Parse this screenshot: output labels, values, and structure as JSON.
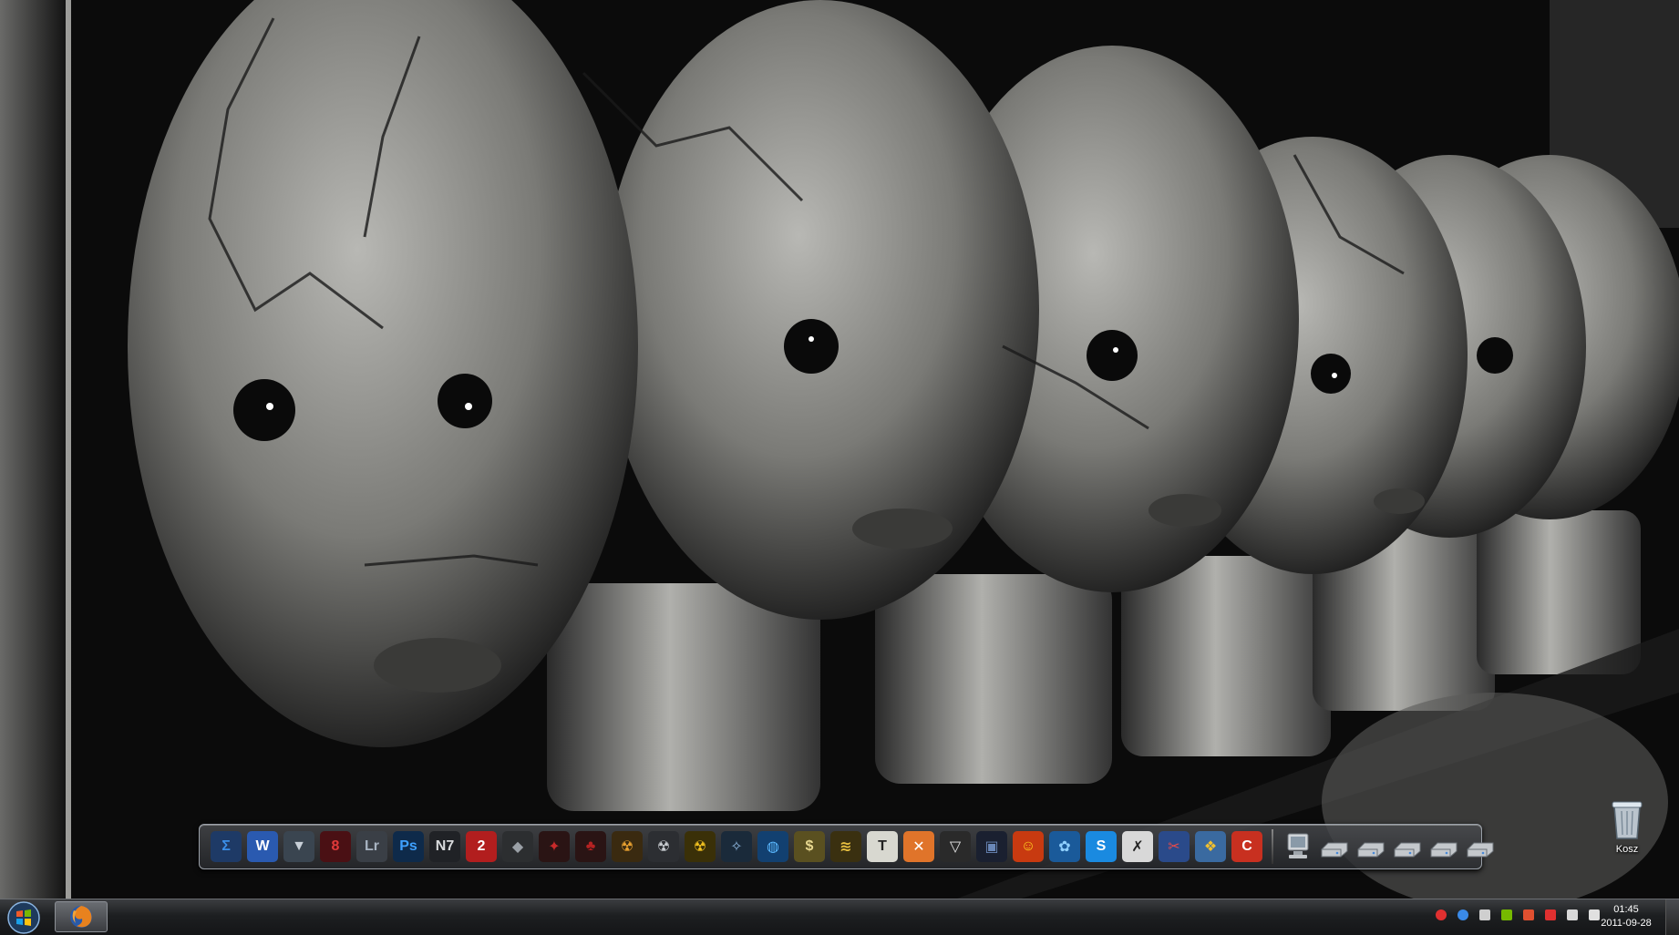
{
  "desktop": {
    "wallpaper": "Black and white photo of cracked porcelain doll heads on stands",
    "icons": [
      {
        "label": "Kosz",
        "icon": "recycle-bin-icon"
      }
    ]
  },
  "dock": {
    "items": [
      {
        "name": "sigma-icon",
        "text": "Σ",
        "bg": "#1e3a66",
        "fg": "#3b8fe8"
      },
      {
        "name": "word-icon",
        "text": "W",
        "bg": "#2a5ab0",
        "fg": "#ffffff"
      },
      {
        "name": "badge-icon",
        "text": "▼",
        "bg": "#3a4550",
        "fg": "#c8d0d8"
      },
      {
        "name": "psp8-icon",
        "text": "8",
        "bg": "#4a1014",
        "fg": "#e23a3a"
      },
      {
        "name": "lightroom-icon",
        "text": "Lr",
        "bg": "#3a3f46",
        "fg": "#a8b4c2"
      },
      {
        "name": "photoshop-icon",
        "text": "Ps",
        "bg": "#0e2a4a",
        "fg": "#3ea0ff"
      },
      {
        "name": "n7-icon",
        "text": "N7",
        "bg": "#202226",
        "fg": "#d8dadc"
      },
      {
        "name": "mass-effect-2-icon",
        "text": "2",
        "bg": "#b21e1e",
        "fg": "#ffffff"
      },
      {
        "name": "shield-icon",
        "text": "◆",
        "bg": "#2c2e30",
        "fg": "#9aa0a6"
      },
      {
        "name": "red-bird-icon",
        "text": "✦",
        "bg": "#2a1414",
        "fg": "#c72a2a"
      },
      {
        "name": "red-tree-icon",
        "text": "♣",
        "bg": "#2a1414",
        "fg": "#b52222"
      },
      {
        "name": "radiation-icon",
        "text": "☢",
        "bg": "#3a2a10",
        "fg": "#e8a030"
      },
      {
        "name": "radiation-grey-icon",
        "text": "☢",
        "bg": "#2c2e32",
        "fg": "#c8ccd0"
      },
      {
        "name": "radiation-yellow-icon",
        "text": "☢",
        "bg": "#3a3008",
        "fg": "#f0c020"
      },
      {
        "name": "starcraft-icon",
        "text": "✧",
        "bg": "#1a2a3a",
        "fg": "#8fb8e0"
      },
      {
        "name": "globe-icon",
        "text": "◍",
        "bg": "#124070",
        "fg": "#5ab8ff"
      },
      {
        "name": "dollar-coin-icon",
        "text": "$",
        "bg": "#5a5020",
        "fg": "#e8d890"
      },
      {
        "name": "cables-icon",
        "text": "≋",
        "bg": "#3a3010",
        "fg": "#e8c040"
      },
      {
        "name": "text-document-icon",
        "text": "T",
        "bg": "#d8d8d0",
        "fg": "#222222"
      },
      {
        "name": "xampp-icon",
        "text": "✕",
        "bg": "#e0742a",
        "fg": "#ffffff"
      },
      {
        "name": "fox-mask-icon",
        "text": "▽",
        "bg": "#2a2a2a",
        "fg": "#e8e8e8"
      },
      {
        "name": "monitor-icon",
        "text": "▣",
        "bg": "#1a2030",
        "fg": "#6a88b8"
      },
      {
        "name": "smiley-icon",
        "text": "☺",
        "bg": "#c83a10",
        "fg": "#ffd020"
      },
      {
        "name": "network-icon",
        "text": "✿",
        "bg": "#1a5a9a",
        "fg": "#8fd0ff"
      },
      {
        "name": "skype-icon",
        "text": "S",
        "bg": "#1a8ae0",
        "fg": "#ffffff"
      },
      {
        "name": "xfire-icon",
        "text": "✗",
        "bg": "#d8d8d8",
        "fg": "#222222"
      },
      {
        "name": "tools-icon",
        "text": "✂",
        "bg": "#2a4a8a",
        "fg": "#e84a4a"
      },
      {
        "name": "cubes-icon",
        "text": "❖",
        "bg": "#3a6aa0",
        "fg": "#f0c030"
      },
      {
        "name": "ccleaner-icon",
        "text": "C",
        "bg": "#c83020",
        "fg": "#ffffff"
      }
    ],
    "drives": [
      {
        "name": "computer-icon"
      },
      {
        "name": "drive-icon-1"
      },
      {
        "name": "drive-icon-2"
      },
      {
        "name": "drive-icon-3"
      },
      {
        "name": "drive-icon-4"
      },
      {
        "name": "drive-icon-5"
      }
    ]
  },
  "taskbar": {
    "start_icon": "windows-orb-icon",
    "pinned": [
      {
        "name": "firefox-icon"
      }
    ],
    "tray": [
      {
        "name": "red-circle-tray-icon",
        "color": "#e03030"
      },
      {
        "name": "blue-bolt-tray-icon",
        "color": "#3a8ae8"
      },
      {
        "name": "network-bars-tray-icon",
        "color": "#cfcfcf"
      },
      {
        "name": "nvidia-tray-icon",
        "color": "#76b900"
      },
      {
        "name": "speaker-red-tray-icon",
        "color": "#e05030"
      },
      {
        "name": "flag-tray-icon",
        "color": "#e03030"
      },
      {
        "name": "monitor-tray-icon",
        "color": "#d8d8d8"
      },
      {
        "name": "volume-tray-icon",
        "color": "#e0e0e0"
      }
    ],
    "clock": {
      "time": "01:45",
      "date": "2011-09-28"
    }
  }
}
